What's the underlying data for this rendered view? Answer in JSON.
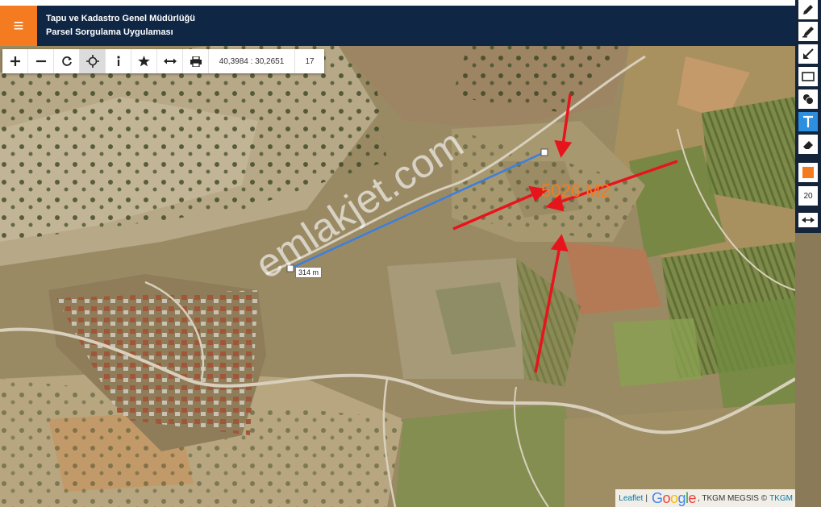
{
  "header": {
    "title_line1": "Tapu ve Kadastro Genel Müdürlüğü",
    "title_line2": "Parsel Sorgulama Uygulaması",
    "menu_icon": "hamburger-icon",
    "brand_color": "#f47b20",
    "bg_color": "#0f2745"
  },
  "toolbar": {
    "buttons": [
      {
        "icon": "zoom-in-icon",
        "glyph": "+"
      },
      {
        "icon": "zoom-out-icon",
        "glyph": "−"
      },
      {
        "icon": "refresh-icon",
        "glyph": "⟳"
      },
      {
        "icon": "locate-icon",
        "glyph": "⊕"
      },
      {
        "icon": "info-icon",
        "glyph": "i"
      },
      {
        "icon": "star-icon",
        "glyph": "★"
      },
      {
        "icon": "measure-icon",
        "glyph": "↔"
      },
      {
        "icon": "print-icon",
        "glyph": "⎙"
      }
    ],
    "coordinates": "40,3984 : 30,2651",
    "zoom_level": "17"
  },
  "right_toolbar": {
    "tools": [
      "pencil-icon",
      "marker-icon",
      "arrow-icon",
      "rectangle-icon",
      "number-icon",
      "text-icon",
      "eraser-icon"
    ],
    "selected_tool": "text-icon",
    "color": "#f47b20",
    "size": "20",
    "nav_icon": "swap-arrows-icon"
  },
  "map": {
    "measurement_label": "314 m",
    "area_label": "5026 M2",
    "watermark": "emlakjet.com",
    "annotation_color": "#e8141c",
    "line_color": "#3b7fe0"
  },
  "attribution": {
    "leaflet": "Leaflet",
    "separator": "|",
    "google": "Google",
    "tkgm_megsis": ", TKGM MEGSIS ©",
    "tkgm": "TKGM"
  }
}
